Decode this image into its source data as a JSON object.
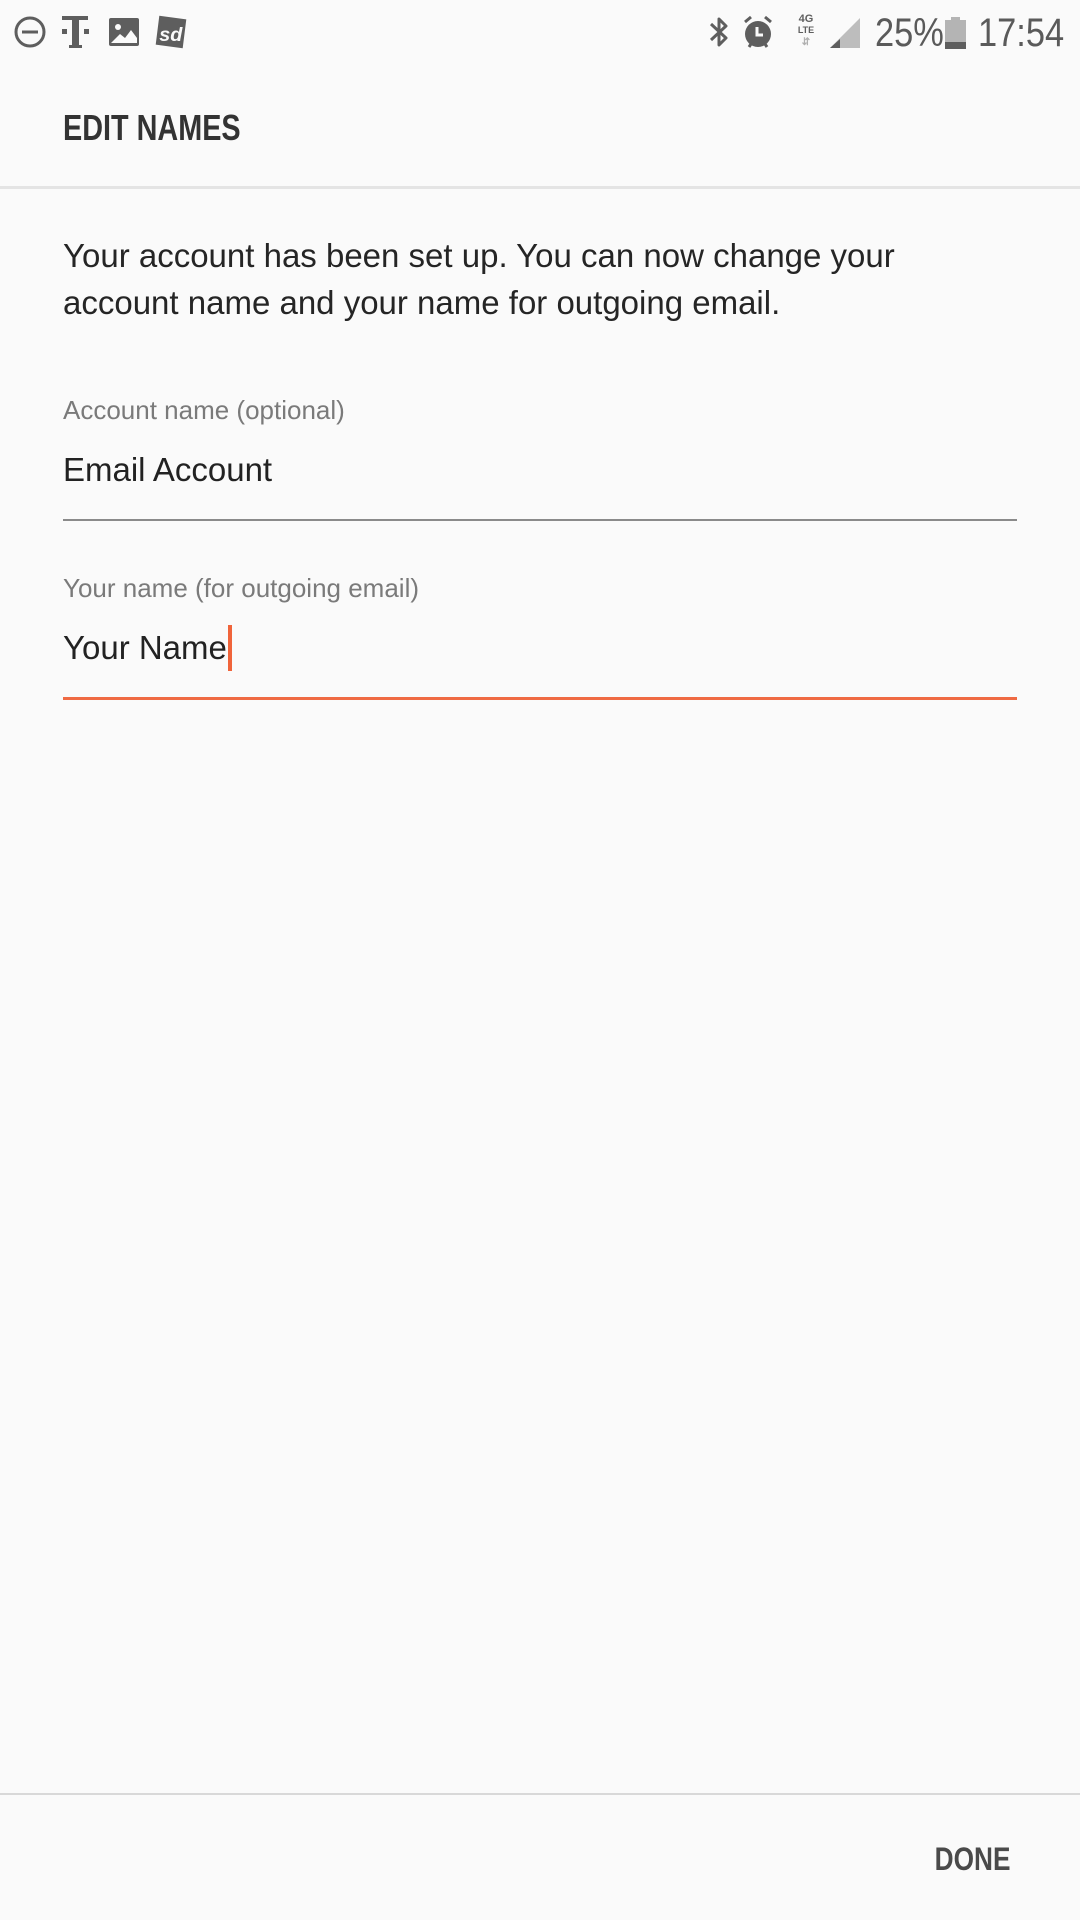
{
  "status_bar": {
    "left_icons": [
      "do-not-disturb-icon",
      "t-mobile-icon",
      "gallery-icon",
      "sd-app-icon"
    ],
    "right_icons": [
      "bluetooth-icon",
      "alarm-icon",
      "4g-lte-icon",
      "signal-icon",
      "battery-icon"
    ],
    "network_label_top": "4G",
    "network_label_bottom": "LTE",
    "battery_percent_text": "25%",
    "battery_level": 0.25,
    "time": "17:54"
  },
  "header": {
    "title": "EDIT NAMES"
  },
  "content": {
    "description_lines": [
      "Your account has been set up. You can now change your",
      "account name and your name for outgoing email."
    ],
    "fields": [
      {
        "label": "Account name (optional)",
        "value": "Email Account",
        "focused": false
      },
      {
        "label": "Your name (for outgoing email)",
        "value": "Your Name",
        "focused": true
      }
    ]
  },
  "footer": {
    "done_label": "DONE"
  },
  "colors": {
    "background": "#fafafa",
    "accent": "#ef6a43",
    "text_primary": "#222222",
    "text_secondary": "#7a7a7a"
  }
}
